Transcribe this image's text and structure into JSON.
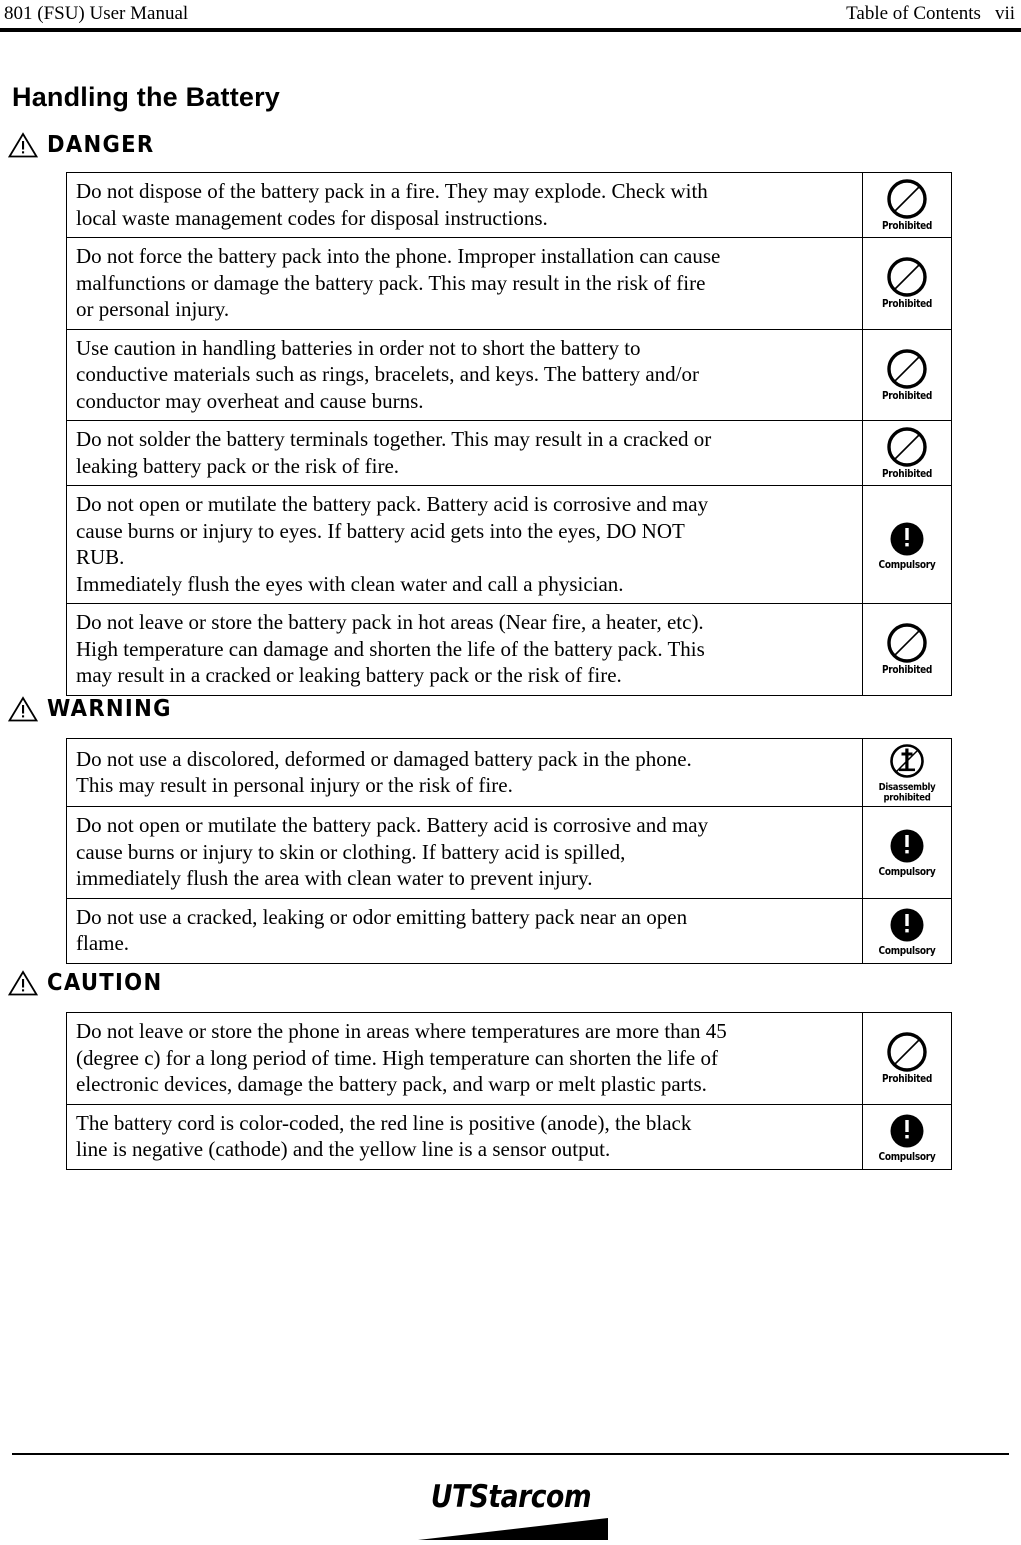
{
  "header": {
    "left_text": "801 (FSU) User Manual",
    "right_text": "Table of Contents",
    "folio": "vii"
  },
  "page_title": "Handling the Battery",
  "sections": [
    {
      "id": "danger",
      "heading": "DANGER",
      "rows": [
        {
          "lines": [
            "Do not dispose of the battery pack in a fire. They may explode. Check with",
            "local waste management codes for disposal instructions."
          ],
          "icon": "prohibited-icon",
          "icon_label": "Prohibited"
        },
        {
          "lines": [
            "Do not force the battery pack into the phone. Improper installation can cause",
            "malfunctions or damage the battery pack. This may result in the risk of fire",
            "or personal injury."
          ],
          "icon": "prohibited-icon",
          "icon_label": "Prohibited"
        },
        {
          "lines": [
            "Use caution in handling batteries in order not to short the battery to",
            "conductive materials such as rings, bracelets, and keys. The battery and/or",
            "conductor may overheat and cause burns."
          ],
          "icon": "prohibited-icon",
          "icon_label": "Prohibited"
        },
        {
          "lines": [
            "Do not solder the battery terminals together. This may result in a cracked or",
            "leaking battery pack or the risk of fire."
          ],
          "icon": "prohibited-icon",
          "icon_label": "Prohibited"
        },
        {
          "lines": [
            "Do not open or mutilate the battery pack. Battery acid is corrosive and may",
            "cause burns or injury to eyes. If battery acid gets into the eyes, DO NOT",
            "RUB.",
            "Immediately flush the eyes with clean water and call a physician."
          ],
          "icon": "compulsory-icon",
          "icon_label": "Compulsory"
        },
        {
          "lines": [
            "Do not leave or store the battery pack in hot areas (Near fire, a heater, etc).",
            "High temperature can damage and shorten the life of the battery pack. This",
            "may result in a cracked or leaking battery pack or the risk of fire."
          ],
          "icon": "prohibited-icon",
          "icon_label": "Prohibited"
        }
      ]
    },
    {
      "id": "warning",
      "heading": "WARNING",
      "rows": [
        {
          "lines": [
            "Do not use a discolored, deformed or damaged battery pack in the phone.",
            "This may result in personal injury or the risk of fire."
          ],
          "icon": "disassembly-prohibited-icon",
          "icon_label": "Disassembly prohibited"
        },
        {
          "lines": [
            "Do not open or mutilate the battery pack. Battery acid is corrosive and may",
            "cause burns or injury to skin or clothing. If battery acid is spilled,",
            "immediately flush the area with clean water to prevent injury."
          ],
          "icon": "compulsory-icon",
          "icon_label": "Compulsory"
        },
        {
          "lines": [
            "Do not use a cracked, leaking or odor emitting battery pack near an open",
            "flame."
          ],
          "icon": "compulsory-icon",
          "icon_label": "Compulsory"
        }
      ]
    },
    {
      "id": "caution",
      "heading": "CAUTION",
      "rows": [
        {
          "lines": [
            "Do not leave or store the phone in areas where temperatures are more than 45",
            "(degree c) for a long period of time. High temperature can shorten the life of",
            "electronic devices, damage the battery pack, and warp or melt plastic parts."
          ],
          "icon": "prohibited-icon",
          "icon_label": "Prohibited"
        },
        {
          "lines": [
            "The battery cord is color-coded, the red line is positive (anode), the black",
            "line is negative (cathode) and the yellow line is a sensor output."
          ],
          "icon": "compulsory-icon",
          "icon_label": "Compulsory"
        }
      ]
    }
  ],
  "footer": {
    "logo_ut": "UT",
    "logo_starcom": "Starcom"
  }
}
